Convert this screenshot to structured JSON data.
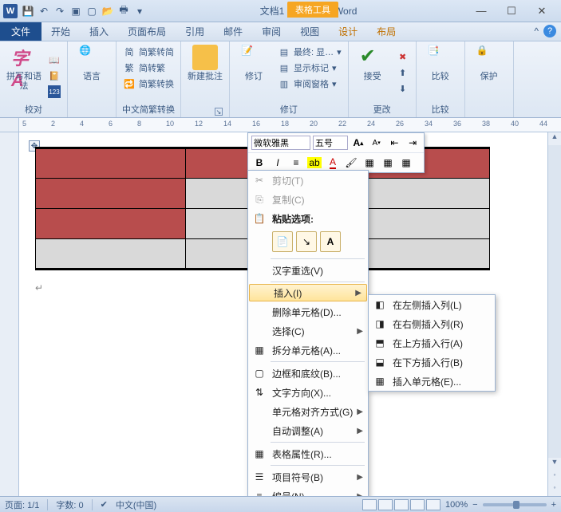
{
  "title": "文档1 - Microsoft Word",
  "tool_tab": "表格工具",
  "tabs": {
    "file": "文件",
    "home": "开始",
    "insert": "插入",
    "layout": "页面布局",
    "ref": "引用",
    "mail": "邮件",
    "review": "审阅",
    "view": "视图",
    "design": "设计",
    "tlayout": "布局"
  },
  "ribbon": {
    "proofing": {
      "spell": "拼写和语法",
      "group": "校对"
    },
    "lang": {
      "label": "语言"
    },
    "chinese": {
      "s2t": "简繁转简",
      "t2s": "简转繁",
      "conv": "简繁转换",
      "group": "中文简繁转换"
    },
    "comment": {
      "new": "新建批注"
    },
    "track": {
      "label": "修订",
      "final": "最终: 显…",
      "show": "显示标记",
      "pane": "审阅窗格",
      "group": "修订"
    },
    "accept": {
      "label": "接受",
      "group": "更改"
    },
    "compare": {
      "label": "比较",
      "group": "比较"
    },
    "protect": {
      "label": "保护"
    }
  },
  "mini": {
    "font": "微软雅黑",
    "size": "五号"
  },
  "ctx": {
    "cut": "剪切(T)",
    "copy": "复制(C)",
    "paste_hdr": "粘贴选项:",
    "reconv": "汉字重选(V)",
    "insert": "插入(I)",
    "delcell": "删除单元格(D)...",
    "select": "选择(C)",
    "split": "拆分单元格(A)...",
    "border": "边框和底纹(B)...",
    "textdir": "文字方向(X)...",
    "align": "单元格对齐方式(G)",
    "autofit": "自动调整(A)",
    "props": "表格属性(R)...",
    "bullets": "项目符号(B)",
    "number": "编号(N)..."
  },
  "sub": {
    "col_left": "在左侧插入列(L)",
    "col_right": "在右侧插入列(R)",
    "row_above": "在上方插入行(A)",
    "row_below": "在下方插入行(B)",
    "cells": "插入单元格(E)..."
  },
  "status": {
    "page": "页面: 1/1",
    "words": "字数: 0",
    "lang": "中文(中国)",
    "zoom": "100%"
  },
  "ruler_ticks": [
    "5",
    "2",
    "4",
    "6",
    "8",
    "10",
    "12",
    "14",
    "16",
    "18",
    "20",
    "22",
    "24",
    "26",
    "34",
    "36",
    "38",
    "40",
    "44"
  ]
}
